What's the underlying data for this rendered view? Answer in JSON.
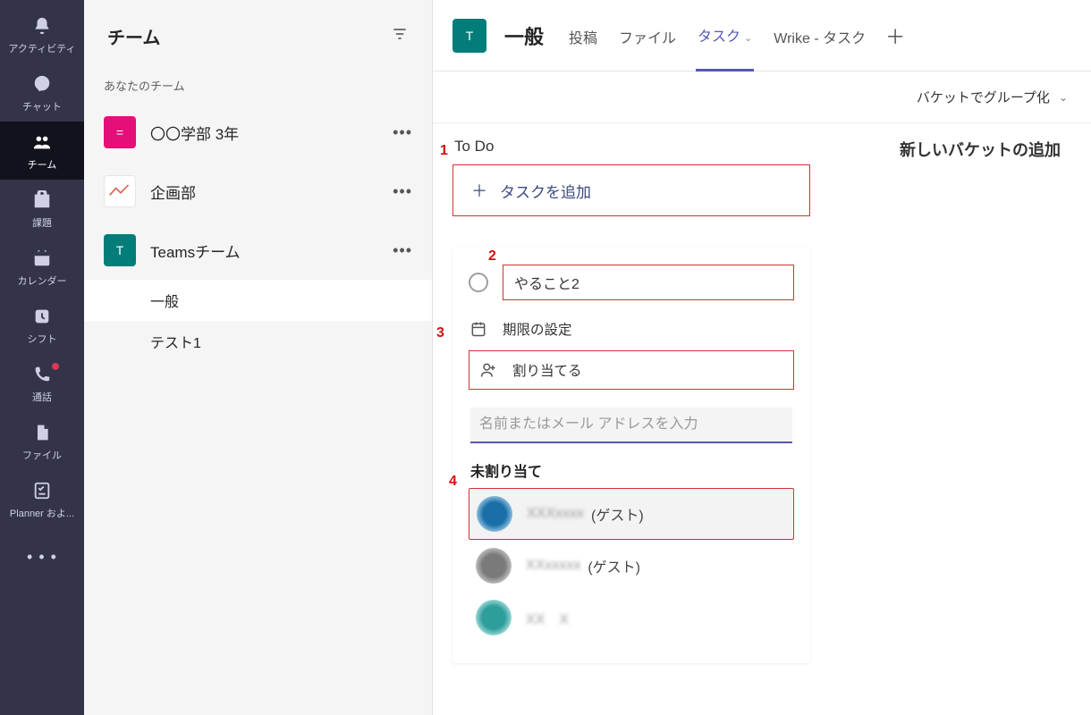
{
  "rail": {
    "items": [
      {
        "label": "アクティビティ",
        "icon": "bell"
      },
      {
        "label": "チャット",
        "icon": "chat"
      },
      {
        "label": "チーム",
        "icon": "teams",
        "active": true
      },
      {
        "label": "課題",
        "icon": "bag"
      },
      {
        "label": "カレンダー",
        "icon": "calendar"
      },
      {
        "label": "シフト",
        "icon": "clock"
      },
      {
        "label": "通話",
        "icon": "phone",
        "notify": true
      },
      {
        "label": "ファイル",
        "icon": "file"
      },
      {
        "label": "Planner およ...",
        "icon": "checklist"
      }
    ]
  },
  "mid": {
    "title": "チーム",
    "section_label": "あなたのチーム",
    "teams": [
      {
        "name": "〇〇学部 3年",
        "avatar": "pink",
        "glyph": "="
      },
      {
        "name": "企画部",
        "avatar": "chart",
        "glyph": ""
      },
      {
        "name": "Teamsチーム",
        "avatar": "teal",
        "glyph": "T",
        "channels": [
          {
            "name": "一般",
            "active": true
          },
          {
            "name": "テスト1"
          }
        ]
      }
    ]
  },
  "main": {
    "avatar_glyph": "T",
    "channel_title": "一般",
    "tabs": [
      {
        "label": "投稿"
      },
      {
        "label": "ファイル"
      },
      {
        "label": "タスク",
        "active": true,
        "hasMenu": true
      },
      {
        "label": "Wrike - タスク"
      }
    ],
    "group_by": "バケットでグループ化"
  },
  "board": {
    "bucket1_title": "To Do",
    "add_task_label": "タスクを追加",
    "task_value": "やること2",
    "due_label": "期限の設定",
    "assign_label": "割り当てる",
    "search_placeholder": "名前またはメール アドレスを入力",
    "unassigned_label": "未割り当て",
    "people": [
      {
        "suffix": "(ゲスト)",
        "avatar": "blue",
        "selected": true
      },
      {
        "suffix": "(ゲスト)",
        "avatar": "grey"
      },
      {
        "suffix": "",
        "avatar": "teal"
      }
    ],
    "new_bucket_label": "新しいバケットの追加"
  },
  "annotations": {
    "a1": "1",
    "a2": "2",
    "a3": "3",
    "a4": "4"
  }
}
